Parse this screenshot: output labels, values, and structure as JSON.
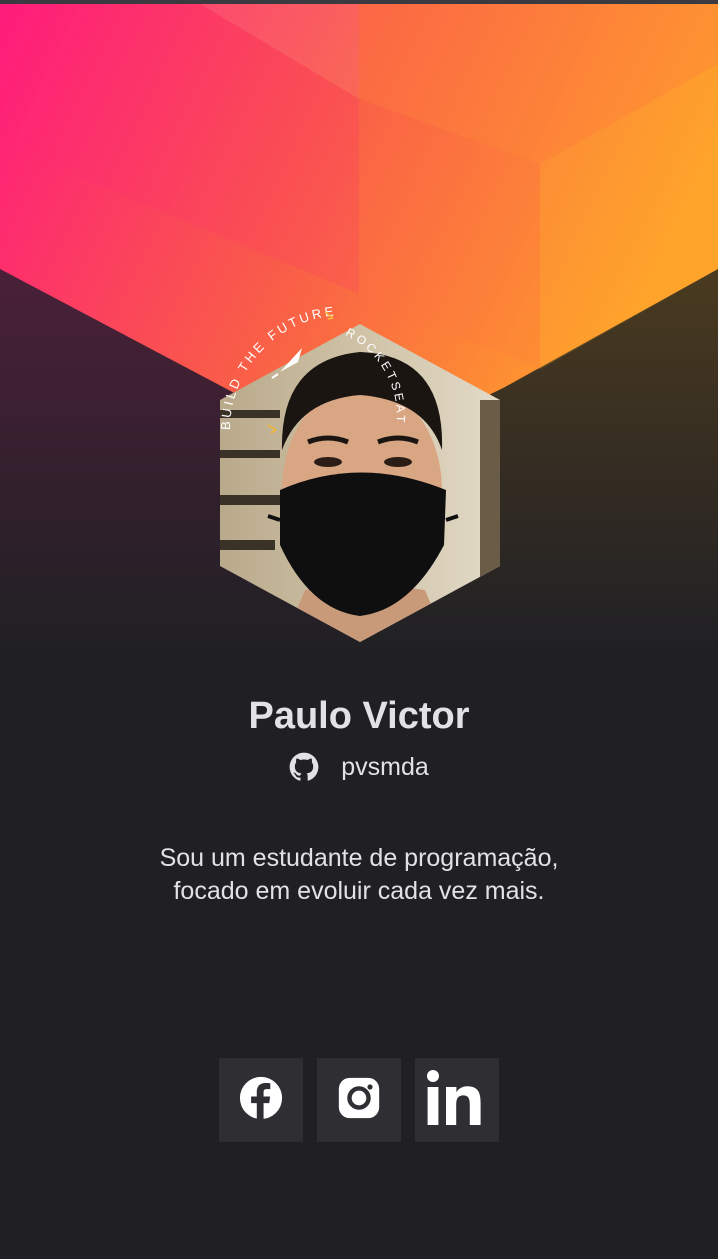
{
  "profile": {
    "name": "Paulo Victor",
    "github_username": "pvsmda",
    "bio": "Sou um estudante de programação, focado em evoluir cada vez mais.",
    "avatar_alt": "Paulo Victor"
  },
  "badge": {
    "ring_text_left": "BUILD THE FUTURE",
    "ring_text_right": "ROCKETSEAT"
  },
  "socials": [
    {
      "name": "facebook",
      "icon": "facebook-icon"
    },
    {
      "name": "instagram",
      "icon": "instagram-icon"
    },
    {
      "name": "linkedin",
      "icon": "linkedin-icon"
    }
  ],
  "colors": {
    "background": "#202024",
    "text": "#e1e1e6",
    "button_bg": "#2e2e33",
    "gradient_pink": "#ff1a7d",
    "gradient_orange": "#ff9a2e",
    "accent_yellow": "#f7b733"
  }
}
